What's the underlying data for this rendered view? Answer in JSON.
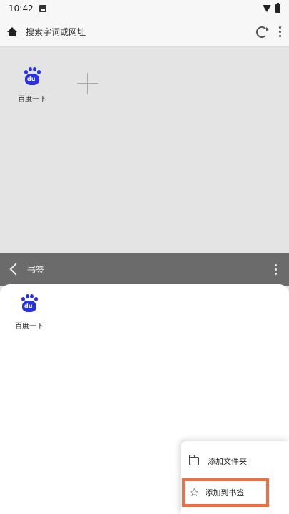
{
  "status_bar": {
    "time": "10:42"
  },
  "address_bar": {
    "placeholder": "搜索字词或网址"
  },
  "speed_dial": {
    "tiles": [
      {
        "label": "百度一下",
        "logo_text": "du"
      }
    ]
  },
  "bookmarks": {
    "title": "书签",
    "items": [
      {
        "label": "百度一下",
        "logo_text": "du"
      }
    ]
  },
  "popup_menu": {
    "items": [
      {
        "label": "添加文件夹"
      },
      {
        "label": "添加到书签"
      }
    ],
    "highlight_color": "#f26e3f"
  },
  "colors": {
    "baidu_blue": "#2932e1",
    "header_gray": "#6b6b6b"
  }
}
